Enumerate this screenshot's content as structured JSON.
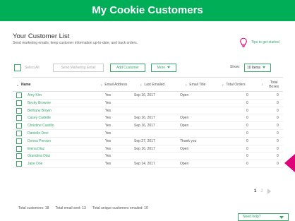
{
  "banner": {
    "title": "My Cookie Customers"
  },
  "header": {
    "title": "Your Customer List",
    "subtitle": "Send marketing emails, keep customer information up-to-date, and track orders.",
    "tips_link": "Tips to get started",
    "tips_icon": "lightbulb-icon"
  },
  "toolbar": {
    "select_all": "Select All",
    "send_email": "Send Marketing Email",
    "add_customer": "Add Customer",
    "more": "More",
    "show_label": "Show:",
    "items_per_page": "10 Items"
  },
  "table": {
    "columns": [
      "Name",
      "Email Address",
      "Last Emailed",
      "Email Title",
      "Total Orders",
      "Total Boxes"
    ],
    "rows": [
      {
        "name": "Amy Kim",
        "email": "Yes",
        "last_emailed": "Sep 16, 2017",
        "email_title": "Open",
        "orders": "0",
        "boxes": "0"
      },
      {
        "name": "Becky Brownie",
        "email": "Yes",
        "last_emailed": "",
        "email_title": "",
        "orders": "0",
        "boxes": "0"
      },
      {
        "name": "Bethany Brown",
        "email": "Yes",
        "last_emailed": "",
        "email_title": "",
        "orders": "0",
        "boxes": "0"
      },
      {
        "name": "Casey Cadette",
        "email": "Yes",
        "last_emailed": "Sep 16, 2017",
        "email_title": "Open",
        "orders": "0",
        "boxes": "0"
      },
      {
        "name": "Christine Castillo",
        "email": "Yes",
        "last_emailed": "Sep 16, 2017",
        "email_title": "Open",
        "orders": "0",
        "boxes": "0"
      },
      {
        "name": "Danielle Devi",
        "email": "Yes",
        "last_emailed": "",
        "email_title": "",
        "orders": "0",
        "boxes": "0"
      },
      {
        "name": "Donna Pierson",
        "email": "Yes",
        "last_emailed": "Sep 27, 2017",
        "email_title": "Thank you",
        "orders": "0",
        "boxes": "0"
      },
      {
        "name": "Elena Diaz",
        "email": "Yes",
        "last_emailed": "Sep 16, 2017",
        "email_title": "Open",
        "orders": "0",
        "boxes": "0"
      },
      {
        "name": "Grandma Diaz",
        "email": "Yes",
        "last_emailed": "",
        "email_title": "",
        "orders": "0",
        "boxes": "0"
      },
      {
        "name": "Jane Doe",
        "email": "Yes",
        "last_emailed": "Sep 14, 2017",
        "email_title": "Open",
        "orders": "0",
        "boxes": "0"
      }
    ]
  },
  "pagination": {
    "current": "1",
    "next": "2"
  },
  "totals": {
    "customers": "Total customers: 18",
    "emails_sent": "Total email sent: 13",
    "unique_emailed": "Total unique customers emailed: 10"
  },
  "help": {
    "label": "Need help?"
  },
  "colors": {
    "brand": "#00ae58",
    "accent": "#3aa76d",
    "pointer": "#e0007a"
  }
}
